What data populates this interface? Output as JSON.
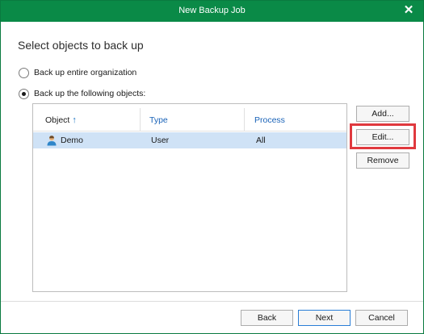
{
  "window": {
    "title": "New Backup Job"
  },
  "section_title": "Select objects to back up",
  "options": [
    {
      "label": "Back up entire organization",
      "selected": false
    },
    {
      "label": "Back up the following objects:",
      "selected": true
    }
  ],
  "table": {
    "columns": [
      "Object",
      "Type",
      "Process"
    ],
    "sort_indicator": "↑",
    "rows": [
      {
        "object": "Demo",
        "type": "User",
        "process": "All",
        "selected": true
      }
    ]
  },
  "side_buttons": {
    "add": "Add...",
    "edit": "Edit...",
    "remove": "Remove"
  },
  "footer_buttons": {
    "back": "Back",
    "next": "Next",
    "cancel": "Cancel"
  },
  "icons": {
    "close": "close-icon",
    "user": "user-icon"
  },
  "colors": {
    "titlebar": "#0a8a47",
    "selection": "#cfe2f6",
    "highlight": "#e0393e",
    "column_header": "#1a63b8"
  }
}
